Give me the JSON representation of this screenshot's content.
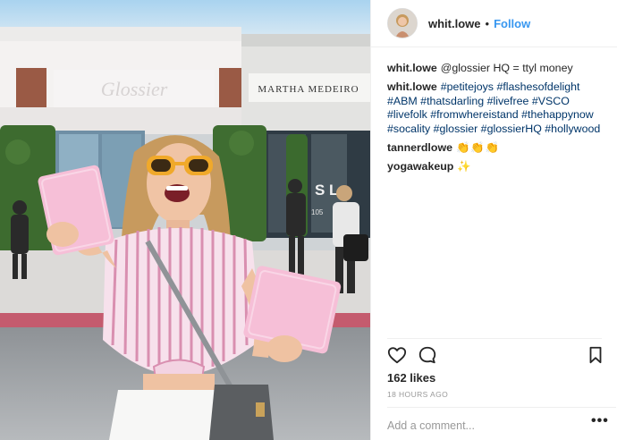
{
  "header": {
    "username": "whit.lowe",
    "separator": "•",
    "follow_label": "Follow",
    "avatar_icon": "profile-avatar"
  },
  "photo": {
    "sign_left": "Glossier",
    "sign_right": "MARTHA MEDEIRO",
    "storefront_letters": "S L",
    "store_number": "105"
  },
  "comments": [
    {
      "username": "whit.lowe",
      "text": "@glossier HQ = ttyl money",
      "icon": ""
    },
    {
      "username": "whit.lowe",
      "text": "#petitejoys #flashesofdelight #ABM #thatsdarling #livefree #VSCO #livefolk #fromwhereistand #thehappynow #socality #glossier #glossierHQ #hollywood",
      "icon": ""
    },
    {
      "username": "tannerdlowe",
      "text": "👏👏👏",
      "icon": "clapping-hands"
    },
    {
      "username": "yogawakeup",
      "text": "✨",
      "icon": "sparkles"
    }
  ],
  "actions": {
    "like_icon": "heart-icon",
    "comment_icon": "comment-bubble-icon",
    "save_icon": "bookmark-icon"
  },
  "likes": "162 likes",
  "timestamp": "18 HOURS AGO",
  "comment_box": {
    "placeholder": "Add a comment..."
  },
  "more_label": "•••",
  "colors": {
    "link": "#003569",
    "follow": "#3897f0",
    "muted": "#999999",
    "border": "#efefef"
  }
}
